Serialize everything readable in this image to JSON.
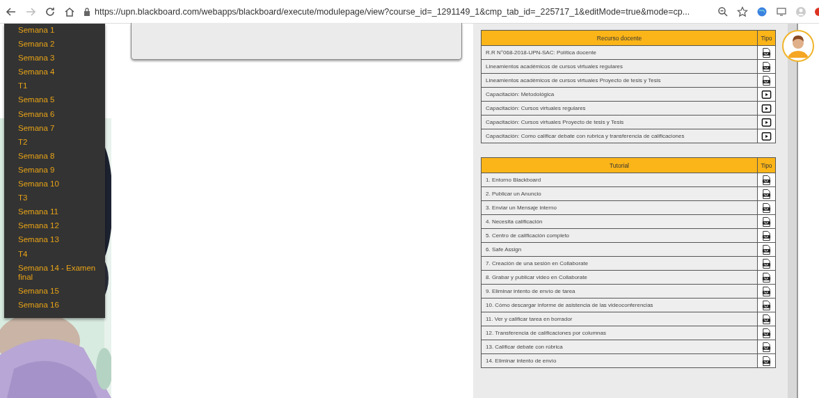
{
  "browser": {
    "url": "https://upn.blackboard.com/webapps/blackboard/execute/modulepage/view?course_id=_1291149_1&cmp_tab_id=_225717_1&editMode=true&mode=cp..."
  },
  "sidebar": {
    "items": [
      {
        "label": "Semana 1"
      },
      {
        "label": "Semana 2"
      },
      {
        "label": "Semana 3"
      },
      {
        "label": "Semana 4"
      },
      {
        "label": "T1"
      },
      {
        "label": "Semana 5"
      },
      {
        "label": "Semana 6"
      },
      {
        "label": "Semana 7"
      },
      {
        "label": "T2"
      },
      {
        "label": "Semana 8"
      },
      {
        "label": "Semana 9"
      },
      {
        "label": "Semana 10"
      },
      {
        "label": "T3"
      },
      {
        "label": "Semana 11"
      },
      {
        "label": "Semana 12"
      },
      {
        "label": "Semana 13"
      },
      {
        "label": "T4"
      },
      {
        "label": "Semana 14 - Examen final"
      },
      {
        "label": "Semana 15"
      },
      {
        "label": "Semana 16"
      }
    ]
  },
  "tables": [
    {
      "title": "Recurso docente",
      "type_header": "Tipo",
      "rows": [
        {
          "title": "R.R N°068-2018-UPN-SAC: Política docente",
          "kind": "pdf"
        },
        {
          "title": "Lineamientos académicos de cursos virtuales regulares",
          "kind": "pdf"
        },
        {
          "title": "Lineamientos académicos de cursos virtuales Proyecto de tesis y Tesis",
          "kind": "pdf"
        },
        {
          "title": "Capacitación: Metodológica",
          "kind": "video"
        },
        {
          "title": "Capacitación: Cursos virtuales regulares",
          "kind": "video"
        },
        {
          "title": "Capacitación: Cursos virtuales Proyecto de tesis y Tesis",
          "kind": "video"
        },
        {
          "title": "Capacitación: Como calificar debate con rubrica y transferencia de calificaciones",
          "kind": "video"
        }
      ]
    },
    {
      "title": "Tutorial",
      "type_header": "Tipo",
      "rows": [
        {
          "title": "1. Entorno Blackboard",
          "kind": "pdf"
        },
        {
          "title": "2. Publicar un Anuncio",
          "kind": "pdf"
        },
        {
          "title": "3. Enviar un Mensaje interno",
          "kind": "pdf"
        },
        {
          "title": "4. Necesita calificación",
          "kind": "pdf"
        },
        {
          "title": "5. Centro de calificación completo",
          "kind": "pdf"
        },
        {
          "title": "6. Safe Assign",
          "kind": "pdf"
        },
        {
          "title": "7. Creación de una sesión en Collaborate",
          "kind": "pdf"
        },
        {
          "title": "8. Grabar y publicar video en Collaborate",
          "kind": "pdf"
        },
        {
          "title": "9. Eliminar intento de envío de tarea",
          "kind": "pdf"
        },
        {
          "title": "10. Cómo descargar informe de asistencia de las videoconferencias",
          "kind": "pdf"
        },
        {
          "title": "11. Ver y calificar tarea en borrador",
          "kind": "pdf"
        },
        {
          "title": "12. Transferencia de calificaciones por columnas",
          "kind": "pdf"
        },
        {
          "title": "13. Calificar debate con rúbrica",
          "kind": "pdf"
        },
        {
          "title": "14. Eliminar intento de envío",
          "kind": "pdf"
        }
      ]
    }
  ]
}
